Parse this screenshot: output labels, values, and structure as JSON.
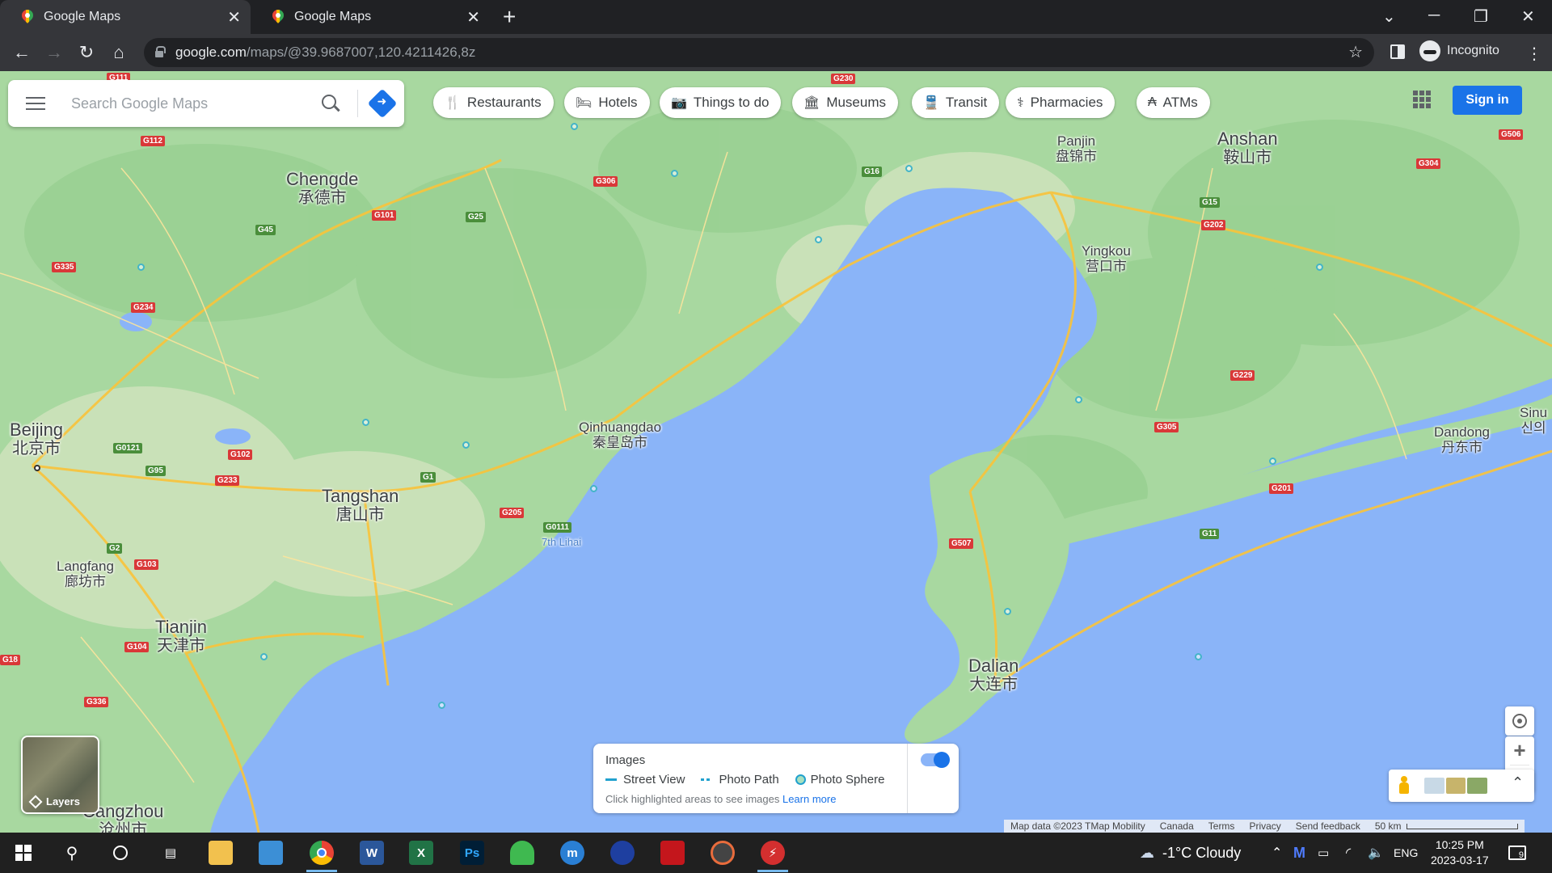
{
  "browser": {
    "tabs": [
      {
        "title": "Google Maps"
      },
      {
        "title": "Google Maps"
      }
    ],
    "new_tab": "+",
    "window_controls": {
      "collapse": "⌄",
      "minimize": "─",
      "restore": "❐",
      "close": "✕"
    },
    "url_host": "google.com",
    "url_path": "/maps/@39.9687007,120.4211426,8z",
    "profile": "Incognito"
  },
  "search": {
    "placeholder": "Search Google Maps"
  },
  "chips": [
    {
      "label": "Restaurants",
      "icon": "🍴"
    },
    {
      "label": "Hotels",
      "icon": "🛏"
    },
    {
      "label": "Things to do",
      "icon": "📷"
    },
    {
      "label": "Museums",
      "icon": "🏛"
    },
    {
      "label": "Transit",
      "icon": "🚆"
    },
    {
      "label": "Pharmacies",
      "icon": "⚕"
    },
    {
      "label": "ATMs",
      "icon": "₳"
    }
  ],
  "account": {
    "sign_in": "Sign in"
  },
  "map": {
    "cities": [
      {
        "en": "Beijing",
        "zh": "北京市"
      },
      {
        "en": "Chengde",
        "zh": "承德市"
      },
      {
        "en": "Tangshan",
        "zh": "唐山市"
      },
      {
        "en": "Tianjin",
        "zh": "天津市"
      },
      {
        "en": "Langfang",
        "zh": "廊坊市"
      },
      {
        "en": "Qinhuangdao",
        "zh": "秦皇岛市"
      },
      {
        "en": "Panjin",
        "zh": "盘锦市"
      },
      {
        "en": "Anshan",
        "zh": "鞍山市"
      },
      {
        "en": "Yingkou",
        "zh": "营口市"
      },
      {
        "en": "Dalian",
        "zh": "大连市"
      },
      {
        "en": "Dandong",
        "zh": "丹东市"
      },
      {
        "en": "Cangzhou",
        "zh": "沧州市"
      },
      {
        "en": "Sinu",
        "zh": "신의"
      }
    ],
    "water_label": "7th Lihai",
    "highways": [
      "G111",
      "G112",
      "G230",
      "G306",
      "G101",
      "G25",
      "G45",
      "G335",
      "G234",
      "G95",
      "G0121",
      "G102",
      "G233",
      "G1",
      "G205",
      "G0111",
      "G2",
      "G103",
      "G104",
      "G336",
      "G18",
      "G16",
      "G15",
      "G202",
      "G229",
      "G304",
      "G506",
      "G305",
      "G201",
      "G11",
      "G507"
    ]
  },
  "layers": {
    "label": "Layers"
  },
  "images_panel": {
    "title": "Images",
    "legend": [
      "Street View",
      "Photo Path",
      "Photo Sphere"
    ],
    "hint": "Click highlighted areas to see images",
    "learn_more": "Learn more"
  },
  "attribution": {
    "map_data": "Map data ©2023 TMap Mobility",
    "region": "Canada",
    "terms": "Terms",
    "privacy": "Privacy",
    "feedback": "Send feedback",
    "scale": "50 km"
  },
  "taskbar": {
    "weather": "-1°C  Cloudy",
    "language": "ENG",
    "time": "10:25 PM",
    "date": "2023-03-17",
    "notifications": "9"
  },
  "colors": {
    "land": "#a8d8a0",
    "water": "#8ab4f8",
    "accent": "#1a73e8",
    "highway": "#f9c33a"
  }
}
